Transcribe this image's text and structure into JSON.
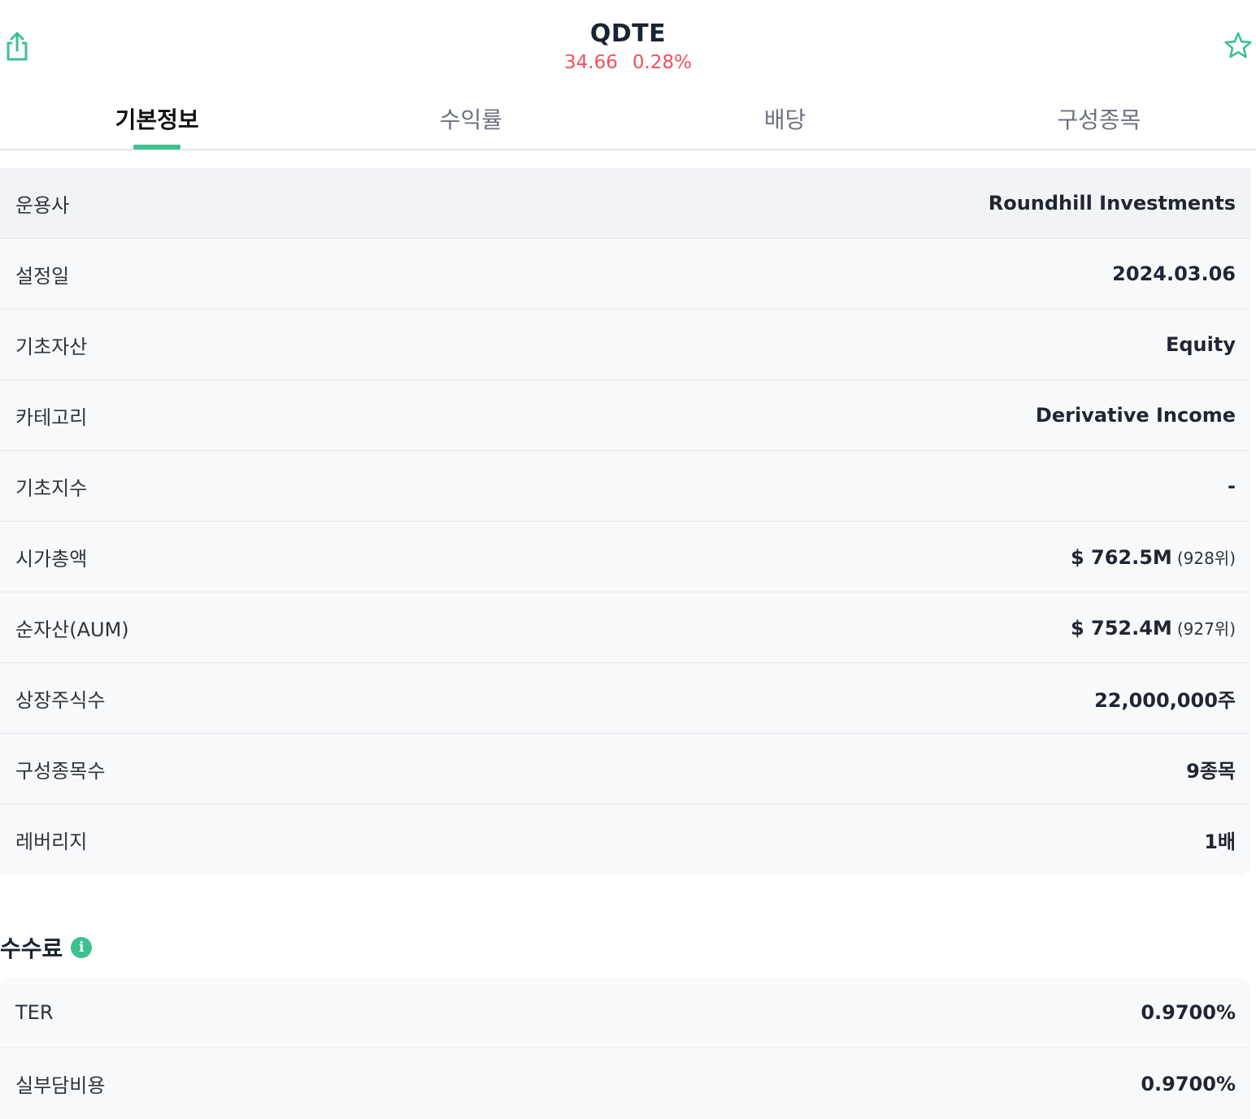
{
  "header": {
    "ticker": "QDTE",
    "price": "34.66",
    "change": "0.28%",
    "share_icon": "share-icon",
    "favorite_icon": "star-outline-icon"
  },
  "tabs": [
    {
      "label": "기본정보",
      "active": true
    },
    {
      "label": "수익률",
      "active": false
    },
    {
      "label": "배당",
      "active": false
    },
    {
      "label": "구성종목",
      "active": false
    }
  ],
  "info": [
    {
      "label": "운용사",
      "value": "Roundhill Investments",
      "sub": ""
    },
    {
      "label": "설정일",
      "value": "2024.03.06",
      "sub": ""
    },
    {
      "label": "기초자산",
      "value": "Equity",
      "sub": ""
    },
    {
      "label": "카테고리",
      "value": "Derivative Income",
      "sub": ""
    },
    {
      "label": "기초지수",
      "value": "-",
      "sub": ""
    },
    {
      "label": "시가총액",
      "value": "$ 762.5M",
      "sub": "(928위)"
    },
    {
      "label": "순자산(AUM)",
      "value": "$ 752.4M",
      "sub": "(927위)"
    },
    {
      "label": "상장주식수",
      "value": "22,000,000주",
      "sub": ""
    },
    {
      "label": "구성종목수",
      "value": "9종목",
      "sub": ""
    },
    {
      "label": "레버리지",
      "value": "1배",
      "sub": ""
    }
  ],
  "fees": {
    "title": "수수료",
    "info_icon": "info-icon",
    "info_glyph": "i",
    "rows": [
      {
        "label": "TER",
        "value": "0.9700%"
      },
      {
        "label": "실부담비용",
        "value": "0.9700%"
      }
    ]
  },
  "colors": {
    "accent": "#3cc28f",
    "price_up": "#f0505e",
    "row_bg": "#f8f9fa"
  }
}
